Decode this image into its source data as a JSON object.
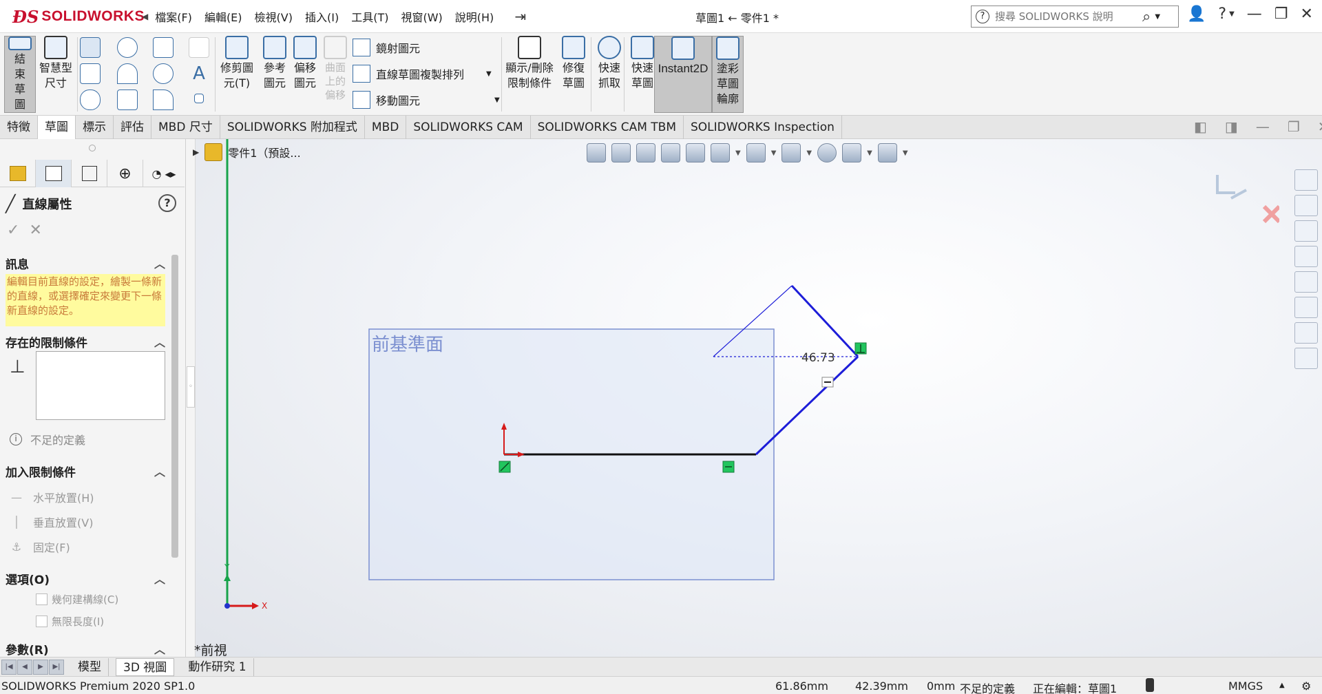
{
  "app": {
    "brand": "SOLIDWORKS",
    "document_title": "草圖1 ← 零件1 *"
  },
  "menu": [
    "檔案(F)",
    "編輯(E)",
    "檢視(V)",
    "插入(I)",
    "工具(T)",
    "視窗(W)",
    "說明(H)"
  ],
  "search": {
    "placeholder": "搜尋 SOLIDWORKS 說明"
  },
  "ribbon": {
    "exit_sketch": "結束草圖",
    "smart_dim": "智慧型尺寸",
    "trim": "修剪圖元(T)",
    "convert": "參考圖元",
    "offset": "偏移圖元",
    "offset_on_surface": "曲面上的偏移",
    "mirror": "鏡射圖元",
    "linear_pattern": "直線草圖複製排列",
    "move": "移動圖元",
    "display_relations": "顯示/刪除限制條件",
    "repair": "修復草圖",
    "quick_snaps": "快速抓取",
    "rapid_sketch": "快速草圖",
    "instant2d": "Instant2D",
    "shaded_contours": "塗彩草圖輪廓"
  },
  "command_tabs": [
    "特徵",
    "草圖",
    "標示",
    "評估",
    "MBD 尺寸",
    "SOLIDWORKS 附加程式",
    "MBD",
    "SOLIDWORKS CAM",
    "SOLIDWORKS CAM TBM",
    "SOLIDWORKS Inspection"
  ],
  "active_command_tab": "草圖",
  "property_manager": {
    "title": "直線屬性",
    "message_header": "訊息",
    "message": "編輯目前直線的設定，繪製一條新的直線，或選擇確定來變更下一條新直線的設定。",
    "existing_relations_header": "存在的限制條件",
    "status": "不足的定義",
    "add_relations_header": "加入限制條件",
    "add_relations": [
      "水平放置(H)",
      "垂直放置(V)",
      "固定(F)"
    ],
    "options_header": "選項(O)",
    "options": [
      "幾何建構線(C)",
      "無限長度(I)"
    ],
    "parameters_header": "參數(R)"
  },
  "feature_tree": {
    "root": "零件1（預設..."
  },
  "graphics": {
    "plane_label": "前基準面",
    "dimension_value": "46.73",
    "view_name": "*前視",
    "triad": {
      "x": "X",
      "y": "Y"
    }
  },
  "bottom_tabs": [
    "模型",
    "3D 視圖",
    "動作研究 1"
  ],
  "active_bottom_tab": "3D 視圖",
  "status_bar": {
    "product": "SOLIDWORKS Premium 2020 SP1.0",
    "x_coord": "61.86mm",
    "y_coord": "42.39mm",
    "z_coord": "0mm",
    "definition": "不足的定義",
    "editing": "正在編輯：草圖1",
    "units": "MMGS"
  },
  "colors": {
    "brand_red": "#c8102e",
    "sketch_blue": "#1d1dd8",
    "sketch_black": "#111111",
    "relation_green": "#22c55e",
    "plane_fill": "#dde6f6",
    "plane_border": "#7b8fd0",
    "message_bg": "#fffb9e"
  }
}
